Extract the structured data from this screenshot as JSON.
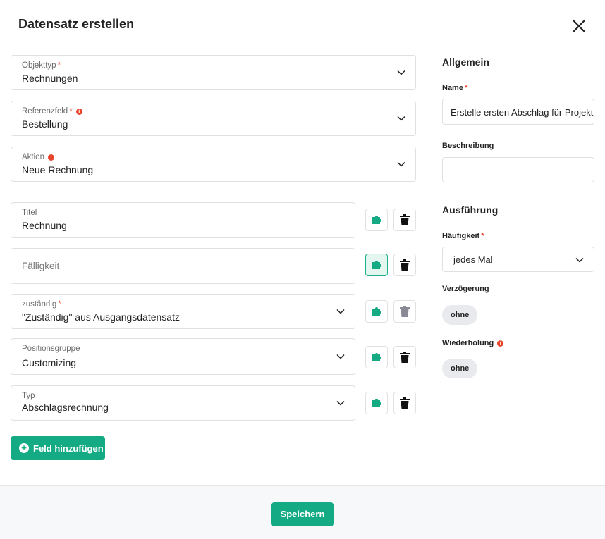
{
  "dialog": {
    "title": "Datensatz erstellen"
  },
  "main": {
    "objekttyp": {
      "label": "Objekttyp",
      "value": "Rechnungen"
    },
    "referenzfeld": {
      "label": "Referenzfeld",
      "value": "Bestellung"
    },
    "aktion": {
      "label": "Aktion",
      "value": "Neue Rechnung"
    },
    "fields": [
      {
        "label": "Titel",
        "value": "Rechnung"
      },
      {
        "label": "Fälligkeit",
        "value": ""
      },
      {
        "label": "zuständig",
        "value": "\"Zuständig\" aus Ausgangsdatensatz"
      },
      {
        "label": "Positionsgruppe",
        "value": "Customizing"
      },
      {
        "label": "Typ",
        "value": "Abschlagsrechnung"
      }
    ],
    "add_field_label": "Feld hinzufügen",
    "required_mark": "*",
    "info_mark": "i"
  },
  "side": {
    "general_heading": "Allgemein",
    "name_label": "Name",
    "name_value": "Erstelle ersten Abschlag für Projekt",
    "description_label": "Beschreibung",
    "description_value": "",
    "execution_heading": "Ausführung",
    "frequency_label": "Häufigkeit",
    "frequency_value": "jedes Mal",
    "delay_label": "Verzögerung",
    "delay_value": "ohne",
    "repeat_label": "Wiederholung",
    "repeat_value": "ohne"
  },
  "footer": {
    "save_label": "Speichern"
  },
  "colors": {
    "accent": "#13aa84",
    "required": "#e8442c",
    "trash": "#111111",
    "trash_disabled": "#8a8a96"
  },
  "icons": {
    "close": "close-icon",
    "chevron": "chevron-down-icon",
    "puzzle": "puzzle-icon",
    "trash": "trash-icon",
    "plus": "plus-circle-icon",
    "info": "info-icon"
  }
}
